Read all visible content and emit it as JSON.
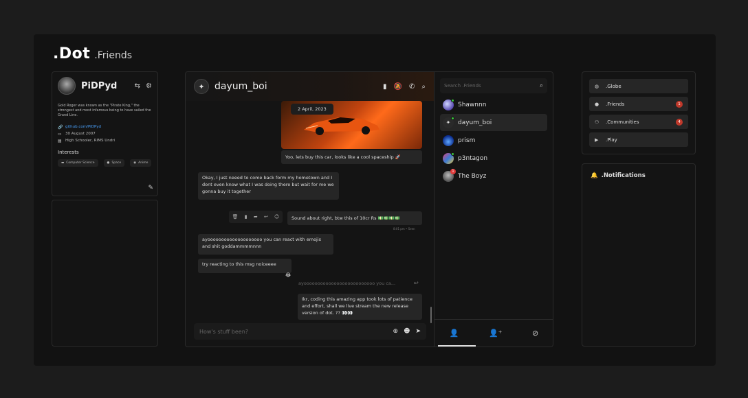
{
  "brand": {
    "logo": ".Dot",
    "section": ".Friends"
  },
  "profile": {
    "name": "PiDPyd",
    "bio": "Gold Roger was known as the \"Pirate King,\" the strongest and most infamous being to have sailed the Grand Line.",
    "github": "github.com/PiDPyd",
    "birthday": "30 August 2007",
    "education": "High Schooler, RIMS Undri",
    "interests_title": "Interests",
    "interests": [
      "Computer Science",
      "Space",
      "Anime"
    ]
  },
  "chat": {
    "contact_name": "dayum_boi",
    "date_pill": "2 April, 2023",
    "messages": {
      "m1": "Yoo, lets buy this car, looks like a cool spaceship 🚀",
      "m2": "Okay, I just neeed to come back form my hometown and I dont even know what I was doing there but wait for me we gonna buy it together",
      "m3": "Sound about right, btw this of 10cr Rs 💵💵💵💵",
      "m3_time": "8:01 pm • Seen",
      "m4": "ayoooooooooooooooooooo you can react with emojis and shit goddammmmnnn",
      "m5": "try reacting to this msg noiceeee",
      "m5_reaction": "😂",
      "reply_preview": "ayoooooooooooooooooooooooooo you ca...",
      "m6": "Ikr, coding this amazing  app took lots of patience and effort, shall we live stream the new release version of dot. ?? 👀👀"
    },
    "composer_placeholder": "How's stuff been?"
  },
  "friends": {
    "search_placeholder": "Search .Friends",
    "list": [
      {
        "name": "Shawnnn",
        "online": true,
        "badge": ""
      },
      {
        "name": "dayum_boi",
        "online": true,
        "badge": ""
      },
      {
        "name": "prism",
        "online": false,
        "badge": ""
      },
      {
        "name": "p3ntagon",
        "online": true,
        "badge": ""
      },
      {
        "name": "The Boyz",
        "online": false,
        "badge": "1"
      }
    ]
  },
  "nav": {
    "items": [
      {
        "label": ".Globe",
        "icon": "globe-icon",
        "badge": ""
      },
      {
        "label": ".Friends",
        "icon": "person-icon",
        "badge": "1"
      },
      {
        "label": ".Communities",
        "icon": "group-icon",
        "badge": "4"
      },
      {
        "label": ".Play",
        "icon": "play-icon",
        "badge": ""
      }
    ]
  },
  "notifications": {
    "title": ".Notifications"
  },
  "colors": {
    "accent_badge": "#c0392b",
    "online": "#3ac93a",
    "link": "#4aa3ff"
  }
}
